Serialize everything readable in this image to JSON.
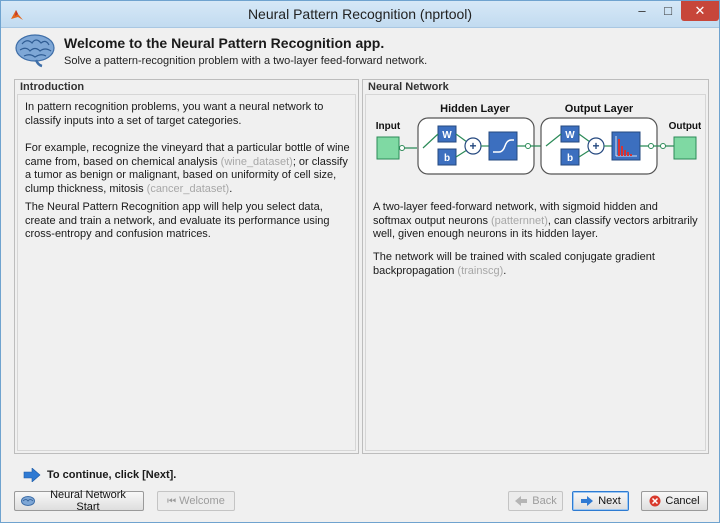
{
  "window": {
    "title": "Neural Pattern Recognition (nprtool)"
  },
  "window_controls": {
    "minimize": "–",
    "maximize": "□",
    "close": "✕"
  },
  "header": {
    "title": "Welcome to the Neural Pattern Recognition app.",
    "subtitle": "Solve a pattern-recognition problem with a two-layer feed-forward network."
  },
  "introduction": {
    "title": "Introduction",
    "p1": "In pattern recognition problems, you want a neural network to classify inputs into a set of target categories.",
    "p2_a": "For example, recognize the vineyard that a particular bottle of wine came from, based on chemical analysis ",
    "p2_link1": "(wine_dataset)",
    "p2_b": "; or classify a tumor as benign or malignant, based on uniformity of cell size, clump thickness, mitosis ",
    "p2_link2": "(cancer_dataset)",
    "p2_c": ".",
    "p3": "The Neural Pattern Recognition app will help you select data, create and train a network, and evaluate its performance using cross-entropy and confusion matrices."
  },
  "network": {
    "title": "Neural Network",
    "diagram": {
      "hidden_layer": "Hidden Layer",
      "output_layer": "Output Layer",
      "input": "Input",
      "output": "Output",
      "w": "W",
      "b": "b",
      "plus": "+"
    },
    "p1_a": "A two-layer feed-forward network, with sigmoid hidden and softmax output neurons ",
    "p1_link": "(patternnet)",
    "p1_b": ", can classify vectors arbitrarily well, given enough neurons in its hidden layer.",
    "p2_a": "The network will be trained with scaled conjugate gradient backpropagation ",
    "p2_link": "(trainscg)",
    "p2_b": "."
  },
  "footer": {
    "continue_text": "To continue, click [Next].",
    "buttons": {
      "nn_start": "Neural Network Start",
      "welcome": "Welcome",
      "back": "Back",
      "next": "Next",
      "cancel": "Cancel"
    }
  },
  "colors": {
    "accent": "#2d7bd2",
    "layer_box": "#3c6fbf",
    "node_green": "#7fd9a3",
    "close_red": "#c7463a"
  }
}
